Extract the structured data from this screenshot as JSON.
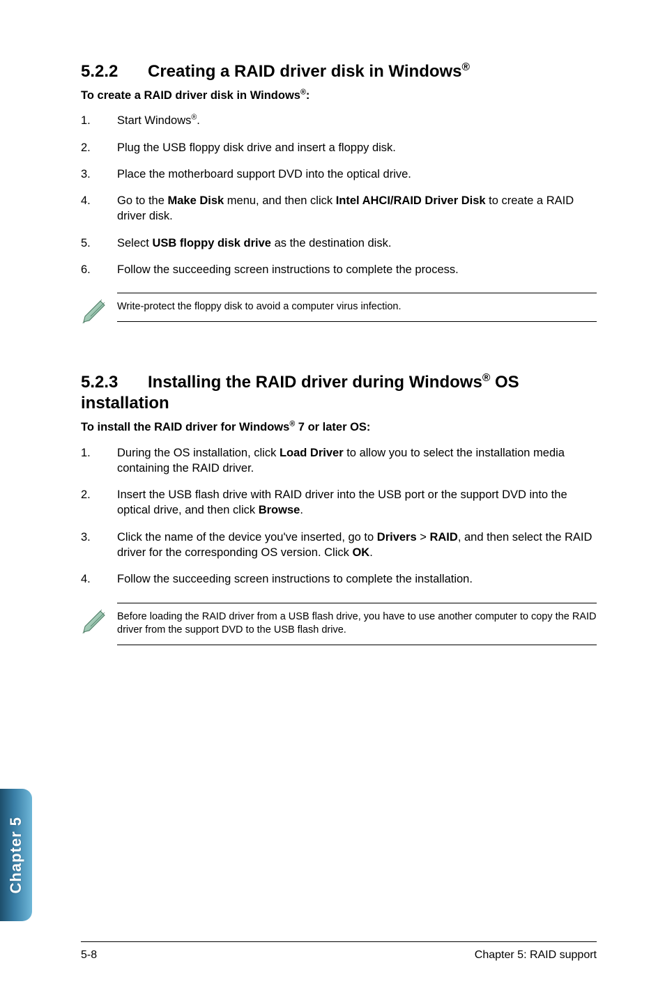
{
  "section1": {
    "number": "5.2.2",
    "title_a": "Creating a RAID driver disk in Windows",
    "title_sup": "®",
    "subhead_a": "To create a RAID driver disk in Windows",
    "subhead_sup": "®",
    "subhead_b": ":",
    "steps": [
      {
        "n": "1.",
        "html": "Start Windows<span class=\"sup\">®</span>."
      },
      {
        "n": "2.",
        "html": "Plug the USB floppy disk drive and insert a floppy disk."
      },
      {
        "n": "3.",
        "html": "Place the motherboard support DVD into the optical drive."
      },
      {
        "n": "4.",
        "html": "Go to the <b>Make Disk</b> menu, and then click <b>Intel AHCI/RAID Driver Disk</b> to create a RAID driver disk."
      },
      {
        "n": "5.",
        "html": "Select <b>USB floppy disk drive</b> as the destination disk."
      },
      {
        "n": "6.",
        "html": "Follow the succeeding screen instructions to complete the process."
      }
    ],
    "note": "Write-protect the floppy disk to avoid a computer virus infection."
  },
  "section2": {
    "number": "5.2.3",
    "title_a": "Installing the RAID driver during Windows",
    "title_sup": "®",
    "title_b": " OS installation",
    "subhead_a": "To install the RAID driver for Windows",
    "subhead_sup": "®",
    "subhead_b": " 7 or later OS:",
    "steps": [
      {
        "n": "1.",
        "html": "During the OS installation, click <b>Load Driver</b> to allow you to select the installation media containing the RAID driver."
      },
      {
        "n": "2.",
        "html": "Insert the USB flash drive with RAID driver into the USB port or the support DVD into the optical drive, and then click <b>Browse</b>."
      },
      {
        "n": "3.",
        "html": "Click the name of the device you've inserted, go to <b>Drivers</b> > <b>RAID</b>, and then select the RAID driver for the corresponding OS version. Click <b>OK</b>."
      },
      {
        "n": "4.",
        "html": "Follow the succeeding screen instructions to complete the installation."
      }
    ],
    "note": "Before loading the RAID driver from a USB flash drive, you have to use another computer to copy the RAID driver from the support DVD to the USB flash drive."
  },
  "sidebar": {
    "label": "Chapter 5"
  },
  "footer": {
    "left": "5-8",
    "right": "Chapter 5: RAID support"
  }
}
